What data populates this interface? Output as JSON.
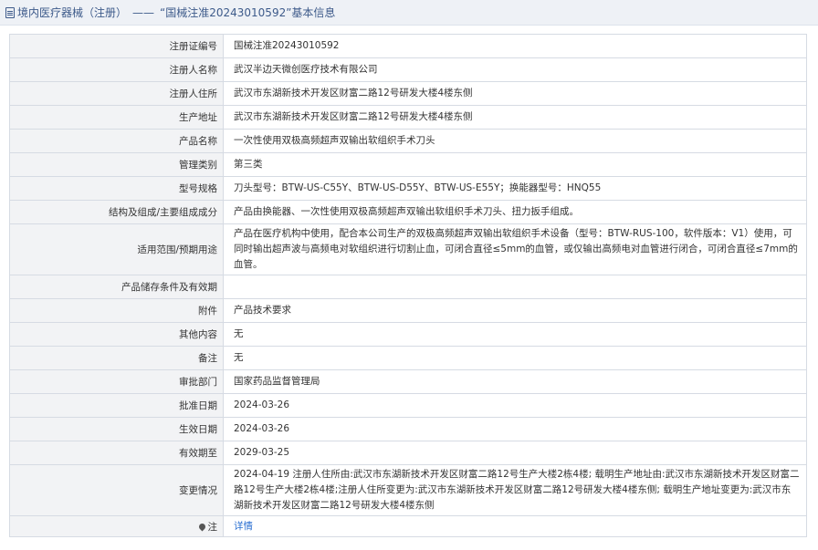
{
  "header": {
    "breadcrumb": "境内医疗器械（注册）",
    "separator": "——",
    "title": "“国械注准20243010592”基本信息"
  },
  "rows": [
    {
      "label": "注册证编号",
      "value": "国械注准20243010592"
    },
    {
      "label": "注册人名称",
      "value": "武汉半边天微创医疗技术有限公司"
    },
    {
      "label": "注册人住所",
      "value": "武汉市东湖新技术开发区财富二路12号研发大楼4楼东侧"
    },
    {
      "label": "生产地址",
      "value": "武汉市东湖新技术开发区财富二路12号研发大楼4楼东侧"
    },
    {
      "label": "产品名称",
      "value": "一次性使用双极高频超声双输出软组织手术刀头"
    },
    {
      "label": "管理类别",
      "value": "第三类"
    },
    {
      "label": "型号规格",
      "value": "刀头型号：BTW-US-C55Y、BTW-US-D55Y、BTW-US-E55Y；换能器型号：HNQ55"
    },
    {
      "label": "结构及组成/主要组成成分",
      "value": "产品由换能器、一次性使用双极高频超声双输出软组织手术刀头、扭力扳手组成。"
    },
    {
      "label": "适用范围/预期用途",
      "value": "产品在医疗机构中使用，配合本公司生产的双极高频超声双输出软组织手术设备（型号：BTW-RUS-100，软件版本：V1）使用，可同时输出超声波与高频电对软组织进行切割止血，可闭合直径≤5mm的血管，或仅输出高频电对血管进行闭合，可闭合直径≤7mm的血管。"
    },
    {
      "label": "产品储存条件及有效期",
      "value": ""
    },
    {
      "label": "附件",
      "value": "产品技术要求"
    },
    {
      "label": "其他内容",
      "value": "无"
    },
    {
      "label": "备注",
      "value": "无"
    },
    {
      "label": "审批部门",
      "value": "国家药品监督管理局"
    },
    {
      "label": "批准日期",
      "value": "2024-03-26"
    },
    {
      "label": "生效日期",
      "value": "2024-03-26"
    },
    {
      "label": "有效期至",
      "value": "2029-03-25"
    },
    {
      "label": "变更情况",
      "value": "2024-04-19 注册人住所由:武汉市东湖新技术开发区财富二路12号生产大楼2栋4楼; 载明生产地址由:武汉市东湖新技术开发区财富二路12号生产大楼2栋4楼;注册人住所变更为:武汉市东湖新技术开发区财富二路12号研发大楼4楼东侧; 载明生产地址变更为:武汉市东湖新技术开发区财富二路12号研发大楼4楼东侧"
    }
  ],
  "note": {
    "label": "注",
    "link_text": "详情"
  }
}
